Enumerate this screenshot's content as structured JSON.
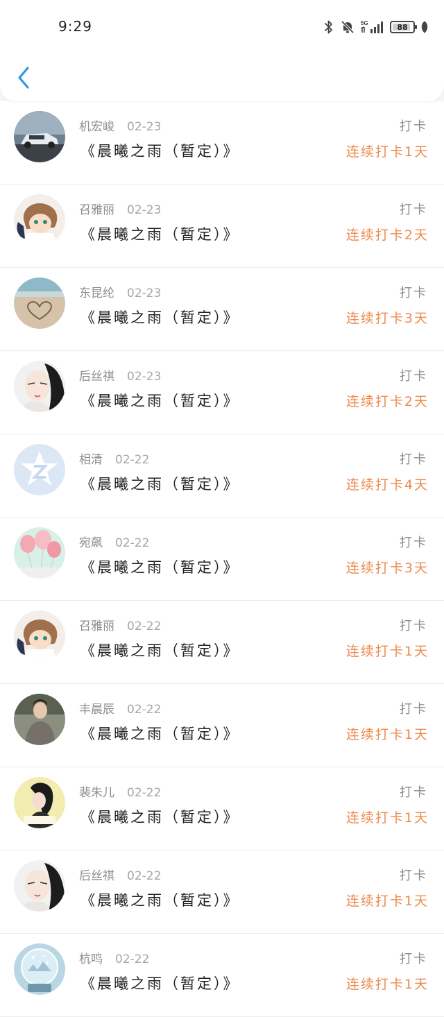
{
  "status_bar": {
    "time": "9:29",
    "battery": "88",
    "battery_level": 0.88,
    "network": "5G"
  },
  "nav": {
    "back_icon": "chevron-left-icon",
    "accent_color": "#2b9ae8"
  },
  "colors": {
    "streak_text": "#ee8a4e"
  },
  "entries": [
    {
      "name": "机宏峻",
      "date": "02-23",
      "title": "《晨曦之雨（暂定）》",
      "type": "打卡",
      "streak": "连续打卡1天",
      "avatar": "car-photo"
    },
    {
      "name": "召雅丽",
      "date": "02-23",
      "title": "《晨曦之雨（暂定）》",
      "type": "打卡",
      "streak": "连续打卡2天",
      "avatar": "anime-character"
    },
    {
      "name": "东昆纶",
      "date": "02-23",
      "title": "《晨曦之雨（暂定）》",
      "type": "打卡",
      "streak": "连续打卡3天",
      "avatar": "beach-heart"
    },
    {
      "name": "后丝祺",
      "date": "02-23",
      "title": "《晨曦之雨（暂定）》",
      "type": "打卡",
      "streak": "连续打卡2天",
      "avatar": "girl-portrait"
    },
    {
      "name": "相清",
      "date": "02-22",
      "title": "《晨曦之雨（暂定）》",
      "type": "打卡",
      "streak": "连续打卡4天",
      "avatar": "qq-default"
    },
    {
      "name": "宛飙",
      "date": "02-22",
      "title": "《晨曦之雨（暂定）》",
      "type": "打卡",
      "streak": "连续打卡3天",
      "avatar": "pink-balloons"
    },
    {
      "name": "召雅丽",
      "date": "02-22",
      "title": "《晨曦之雨（暂定）》",
      "type": "打卡",
      "streak": "连续打卡1天",
      "avatar": "anime-character"
    },
    {
      "name": "丰晨辰",
      "date": "02-22",
      "title": "《晨曦之雨（暂定）》",
      "type": "打卡",
      "streak": "连续打卡1天",
      "avatar": "man-portrait"
    },
    {
      "name": "裴朱儿",
      "date": "02-22",
      "title": "《晨曦之雨（暂定）》",
      "type": "打卡",
      "streak": "连续打卡1天",
      "avatar": "girl-yellow"
    },
    {
      "name": "后丝祺",
      "date": "02-22",
      "title": "《晨曦之雨（暂定）》",
      "type": "打卡",
      "streak": "连续打卡1天",
      "avatar": "girl-portrait"
    },
    {
      "name": "杭鸣",
      "date": "02-22",
      "title": "《晨曦之雨（暂定）》",
      "type": "打卡",
      "streak": "连续打卡1天",
      "avatar": "snow-globe"
    }
  ]
}
